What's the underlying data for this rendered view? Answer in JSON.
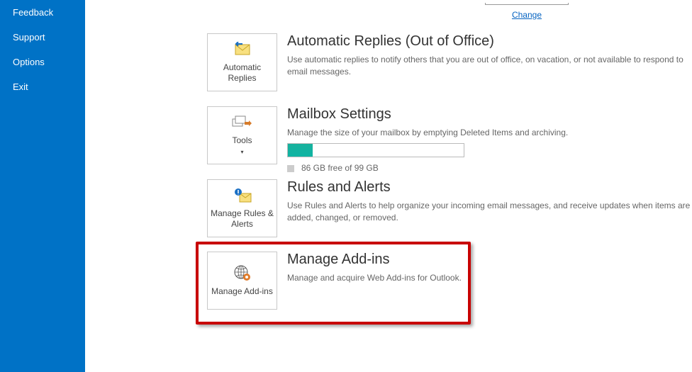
{
  "sidebar": {
    "items": [
      {
        "label": "Feedback"
      },
      {
        "label": "Support"
      },
      {
        "label": "Options"
      },
      {
        "label": "Exit"
      }
    ]
  },
  "top": {
    "change_label": "Change"
  },
  "sections": {
    "auto_reply": {
      "tile_label": "Automatic Replies",
      "title": "Automatic Replies (Out of Office)",
      "desc": "Use automatic replies to notify others that you are out of office, on vacation, or not available to respond to email messages."
    },
    "mailbox": {
      "tile_label": "Tools",
      "title": "Mailbox Settings",
      "desc": "Manage the size of your mailbox by emptying Deleted Items and archiving.",
      "storage_text": "86 GB free of 99 GB"
    },
    "rules": {
      "tile_label": "Manage Rules & Alerts",
      "title": "Rules and Alerts",
      "desc": "Use Rules and Alerts to help organize your incoming email messages, and receive updates when items are added, changed, or removed."
    },
    "addins": {
      "tile_label": "Manage Add-ins",
      "title": "Manage Add-ins",
      "desc": "Manage and acquire Web Add-ins for Outlook."
    }
  }
}
